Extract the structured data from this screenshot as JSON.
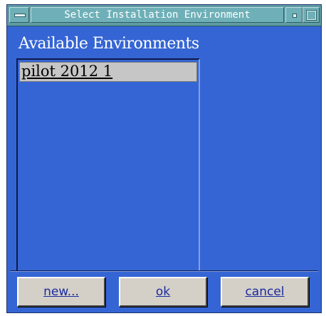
{
  "window": {
    "title": "Select Installation Environment"
  },
  "section": {
    "label": "Available Environments"
  },
  "environments": {
    "items": [
      {
        "label": "pilot 2012 1",
        "selected": true
      }
    ]
  },
  "buttons": {
    "new_label": "new...",
    "ok_label": "ok",
    "cancel_label": "cancel"
  },
  "icons": {
    "menu": "window-menu-icon",
    "minimize": "minimize-icon",
    "maximize": "maximize-icon"
  },
  "colors": {
    "background": "#3565d4",
    "titlebar": "#5f9ca4",
    "selection": "#c6c6c6",
    "button_text": "#1a2aa0"
  }
}
